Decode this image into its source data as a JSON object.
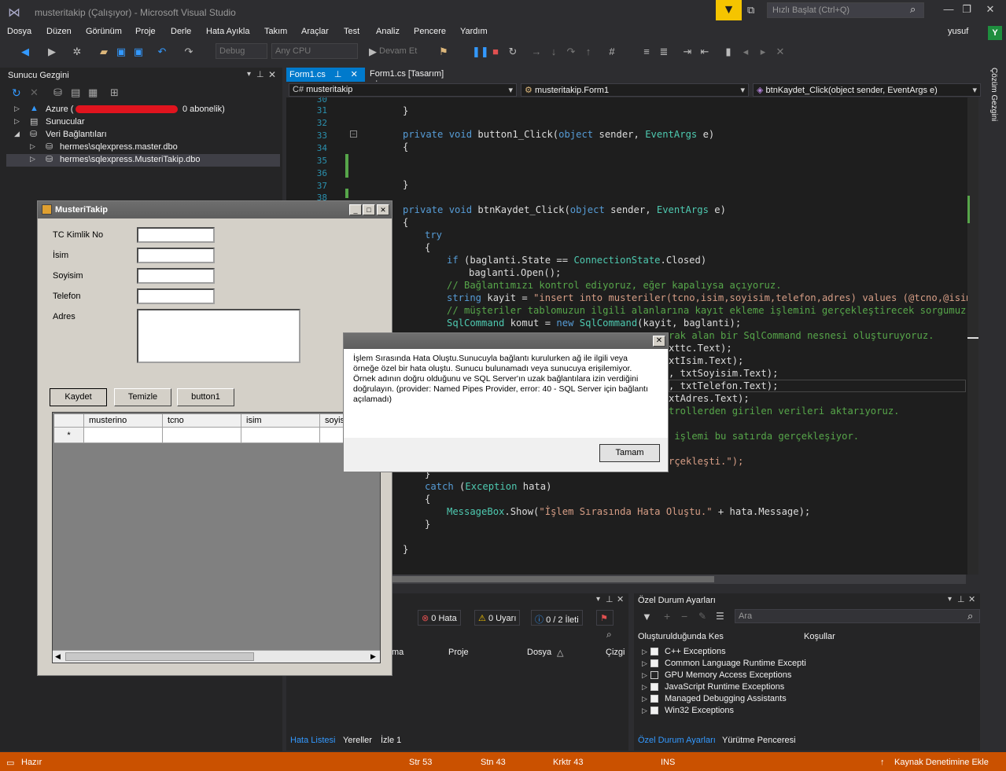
{
  "titlebar": {
    "title": "musteritakip (Çalışıyor) - Microsoft Visual Studio",
    "quick_launch_placeholder": "Hızlı Başlat (Ctrl+Q)",
    "user": "yusuf",
    "user_initial": "Y"
  },
  "menu": [
    "Dosya",
    "Düzen",
    "Görünüm",
    "Proje",
    "Derle",
    "Hata Ayıkla",
    "Takım",
    "Araçlar",
    "Test",
    "Analiz",
    "Pencere",
    "Yardım"
  ],
  "toolbar": {
    "config": "Debug",
    "platform": "Any CPU",
    "continue": "Devam Et"
  },
  "server_explorer": {
    "title": "Sunucu Gezgini",
    "items": [
      {
        "label": "Azure (",
        "suffix": "0 abonelik)"
      },
      {
        "label": "Sunucular"
      },
      {
        "label": "Veri Bağlantıları"
      },
      {
        "label": "hermes\\sqlexpress.master.dbo"
      },
      {
        "label": "hermes\\sqlexpress.MusteriTakip.dbo"
      }
    ]
  },
  "editor": {
    "tabs": [
      {
        "label": "Form1.cs"
      },
      {
        "label": "Form1.cs [Tasarım]"
      }
    ],
    "nav": {
      "project": "musteritakip",
      "class": "musteritakip.Form1",
      "member": "btnKaydet_Click(object sender, EventArgs e)"
    },
    "line_numbers": [
      "30",
      "31",
      "32",
      "33",
      "34",
      "35",
      "36",
      "37",
      "38"
    ],
    "code": {
      "l31": "}",
      "l33_kw": "private void ",
      "l33_name": "button1_Click(",
      "l33_type": "object",
      "l33_rest": " sender, ",
      "l33_type2": "EventArgs",
      "l33_end": " e)",
      "l34": "{",
      "l37": "}",
      "l39_kw": "private void ",
      "l39_name": "btnKaydet_Click(",
      "l39_type": "object",
      "l39_rest": " sender, ",
      "l39_type2": "EventArgs",
      "l39_end": " e)",
      "l40": "{",
      "l41": "try",
      "l42": "{",
      "l43_a": "if (baglanti.State == ",
      "l43_b": "ConnectionState",
      "l43_c": ".Closed)",
      "l44": "baglanti.Open();",
      "l45": "// Bağlantımızı kontrol ediyoruz, eğer kapalıysa açıyoruz.",
      "l46_a": "string",
      "l46_b": " kayit = ",
      "l46_c": "\"insert into musteriler(tcno,isim,soyisim,telefon,adres) values (@tcno,@isim,@so",
      "l47": "// müşteriler tablomuzun ilgili alanlarına kayıt ekleme işlemini gerçekleştirecek sorgumuz.",
      "l48_a": "SqlCommand",
      "l48_b": " komut = ",
      "l48_c": "new ",
      "l48_d": "SqlCommand",
      "l48_e": "(kayit, baglanti);",
      "l49": "rak alan bir SqlCommand nesnesi oluşturuyoruz.",
      "l50": "xttc.Text);",
      "l51": "xtIsim.Text);",
      "l52": ", txtSoyisim.Text);",
      "l53": ", txtTelefon.Text);",
      "l54": "xtAdres.Text);",
      "l55": "trollerden girilen verileri aktarıyoruz.",
      "l57": " işlemi bu satırda gerçekleşiyor.",
      "l59": "rçekleşti.\");",
      "l60": "}",
      "l61_a": "catch",
      "l61_b": " (",
      "l61_c": "Exception",
      "l61_d": " hata)",
      "l62": "{",
      "l63_a": "MessageBox",
      "l63_b": ".Show(",
      "l63_c": "\"İşlem Sırasında Hata Oluştu.\"",
      "l63_d": " + hata.Message);",
      "l64": "}",
      "l66": "}"
    }
  },
  "error_list": {
    "errors": "0 Hata",
    "warnings": "0 Uyarı",
    "messages": "0 / 2 İleti",
    "columns": [
      "ma",
      "Proje",
      "Dosya",
      "Çizgi"
    ],
    "tabs": [
      "Hata Listesi",
      "Yereller",
      "İzle 1"
    ]
  },
  "exception_settings": {
    "title": "Özel Durum Ayarları",
    "search_placeholder": "Ara",
    "col_break": "Oluşturulduğunda Kes",
    "col_conditions": "Koşullar",
    "items": [
      {
        "label": "C++ Exceptions",
        "checked": true
      },
      {
        "label": "Common Language Runtime Excepti",
        "checked": true
      },
      {
        "label": "GPU Memory Access Exceptions",
        "checked": false
      },
      {
        "label": "JavaScript Runtime Exceptions",
        "checked": true
      },
      {
        "label": "Managed Debugging Assistants",
        "checked": true
      },
      {
        "label": "Win32 Exceptions",
        "checked": true
      }
    ],
    "tabs": [
      "Özel Durum Ayarları",
      "Yürütme Penceresi"
    ]
  },
  "solution_explorer_label": "Çözüm Gezgini",
  "statusbar": {
    "state": "Hazır",
    "line": "Str 53",
    "col": "Stn 43",
    "char": "Krktr 43",
    "mode": "INS",
    "source_control": "Kaynak Denetimine Ekle"
  },
  "winform": {
    "title": "MusteriTakip",
    "labels": {
      "tc": "TC Kimlik No",
      "isim": "İsim",
      "soyisim": "Soyisim",
      "telefon": "Telefon",
      "adres": "Adres"
    },
    "buttons": {
      "kaydet": "Kaydet",
      "temizle": "Temizle",
      "button1": "button1"
    },
    "grid_columns": [
      "musterino",
      "tcno",
      "isim",
      "soyis"
    ],
    "new_row_marker": "*"
  },
  "messagebox": {
    "text": "İşlem Sırasında Hata Oluştu.Sunucuyla bağlantı kurulurken ağ ile ilgili veya örneğe özel bir hata oluştu. Sunucu bulunamadı veya sunucuya erişilemiyor. Örnek adının doğru olduğunu ve SQL Server'ın uzak bağlantılara izin verdiğini doğrulayın. (provider: Named Pipes Provider, error: 40 - SQL Server için bağlantı açılamadı)",
    "ok": "Tamam"
  }
}
